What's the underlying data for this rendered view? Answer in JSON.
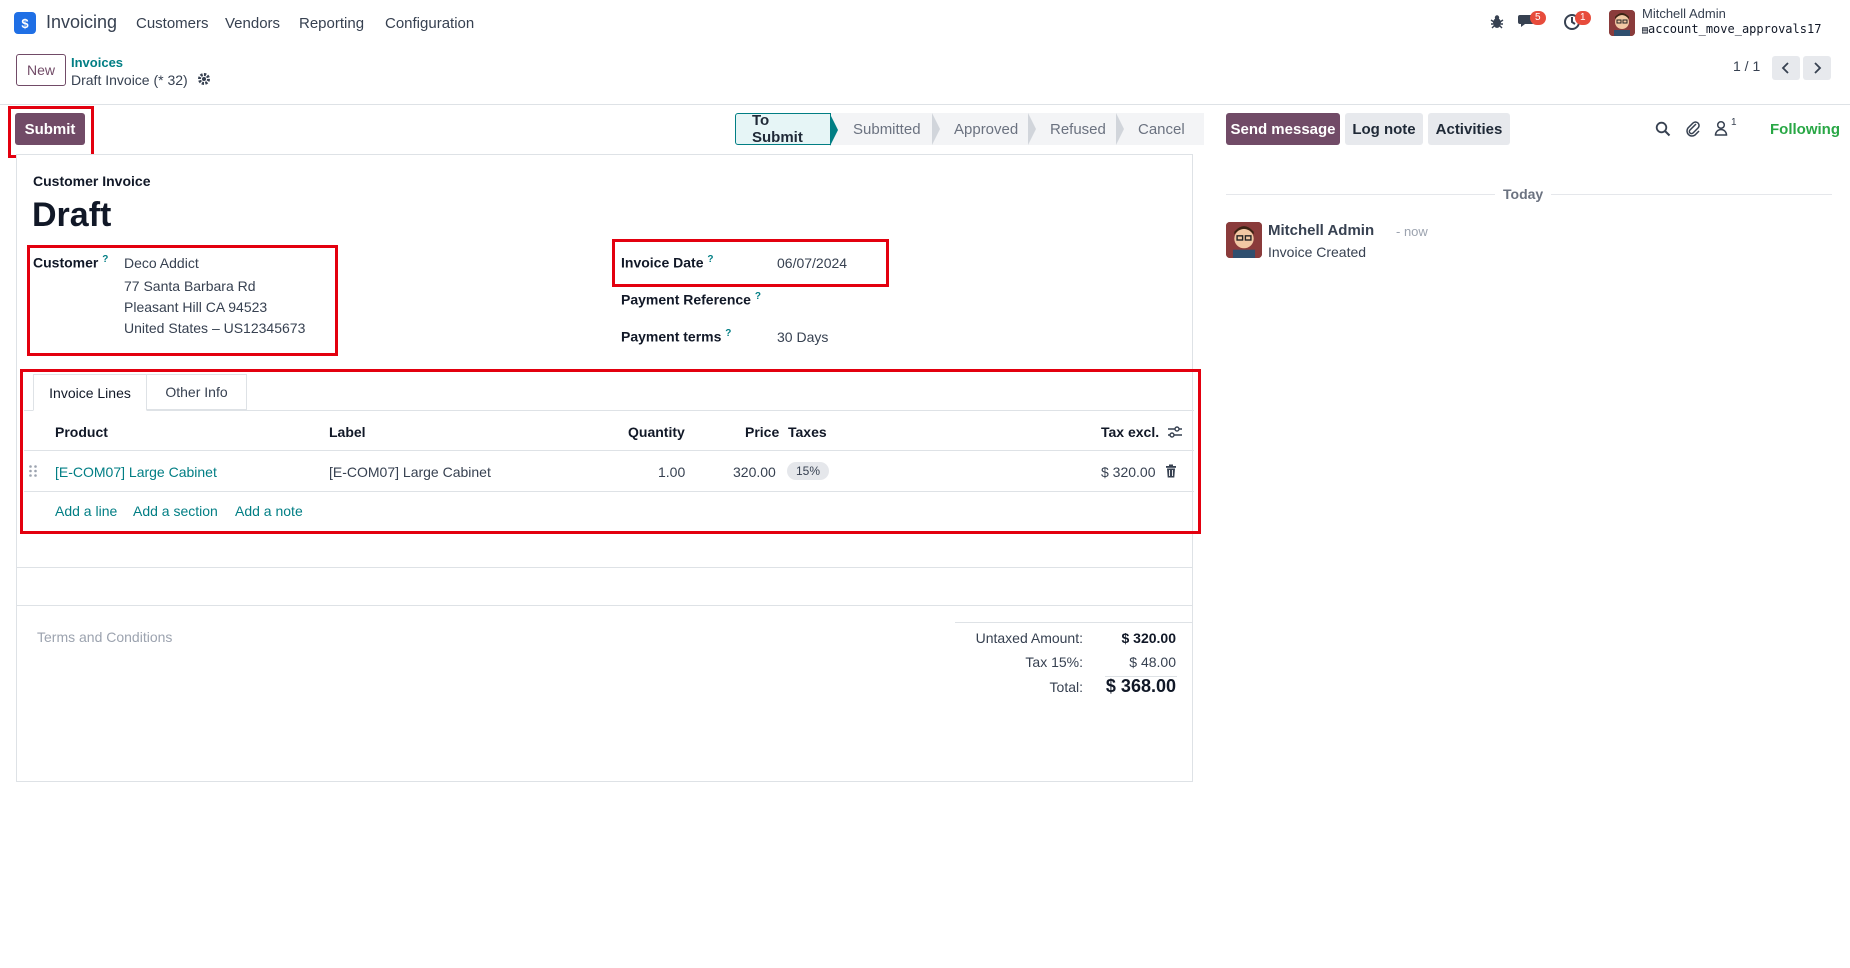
{
  "navbar": {
    "app_name": "Invoicing",
    "logo_letter": "$",
    "menu": [
      "Customers",
      "Vendors",
      "Reporting",
      "Configuration"
    ],
    "messages_count": "5",
    "activities_count": "1",
    "user_name": "Mitchell Admin",
    "db_name": "account_move_approvals17"
  },
  "control": {
    "new_label": "New",
    "breadcrumb_parent": "Invoices",
    "breadcrumb_current": "Draft Invoice (* 32)",
    "pager": "1 / 1"
  },
  "actions": {
    "submit_label": "Submit"
  },
  "statusbar": {
    "stages": [
      "To Submit",
      "Submitted",
      "Approved",
      "Refused",
      "Cancel"
    ],
    "active": "To Submit"
  },
  "form": {
    "move_type": "Customer Invoice",
    "state_title": "Draft",
    "customer_label": "Customer",
    "customer_name": "Deco Addict",
    "customer_address_1": "77 Santa Barbara Rd",
    "customer_address_2": "Pleasant Hill CA 94523",
    "customer_address_3": "United States – US12345673",
    "invoice_date_label": "Invoice Date",
    "invoice_date": "06/07/2024",
    "payment_reference_label": "Payment Reference",
    "payment_terms_label": "Payment terms",
    "payment_terms": "30 Days",
    "tabs": [
      "Invoice Lines",
      "Other Info"
    ],
    "columns": [
      "Product",
      "Label",
      "Quantity",
      "Price",
      "Taxes",
      "Tax excl."
    ],
    "lines": [
      {
        "product": "[E-COM07] Large Cabinet",
        "label": "[E-COM07] Large Cabinet",
        "quantity": "1.00",
        "price": "320.00",
        "tax": "15%",
        "subtotal": "$ 320.00"
      }
    ],
    "add_line": "Add a line",
    "add_section": "Add a section",
    "add_note": "Add a note",
    "terms_placeholder": "Terms and Conditions",
    "untaxed_label": "Untaxed Amount:",
    "untaxed_value": "$ 320.00",
    "tax_label": "Tax 15%:",
    "tax_value": "$ 48.00",
    "total_label": "Total:",
    "total_value": "$ 368.00"
  },
  "chatter": {
    "send_message": "Send message",
    "log_note": "Log note",
    "activities": "Activities",
    "followers_count": "1",
    "following": "Following",
    "date_separator": "Today",
    "message_author": "Mitchell Admin",
    "message_time": "- now",
    "message_body": "Invoice Created"
  },
  "colors": {
    "primary": "#714b67",
    "accent_teal": "#017e84",
    "highlight_red": "#e3000f",
    "badge_red": "#e74c3c",
    "following_green": "#28a745"
  }
}
